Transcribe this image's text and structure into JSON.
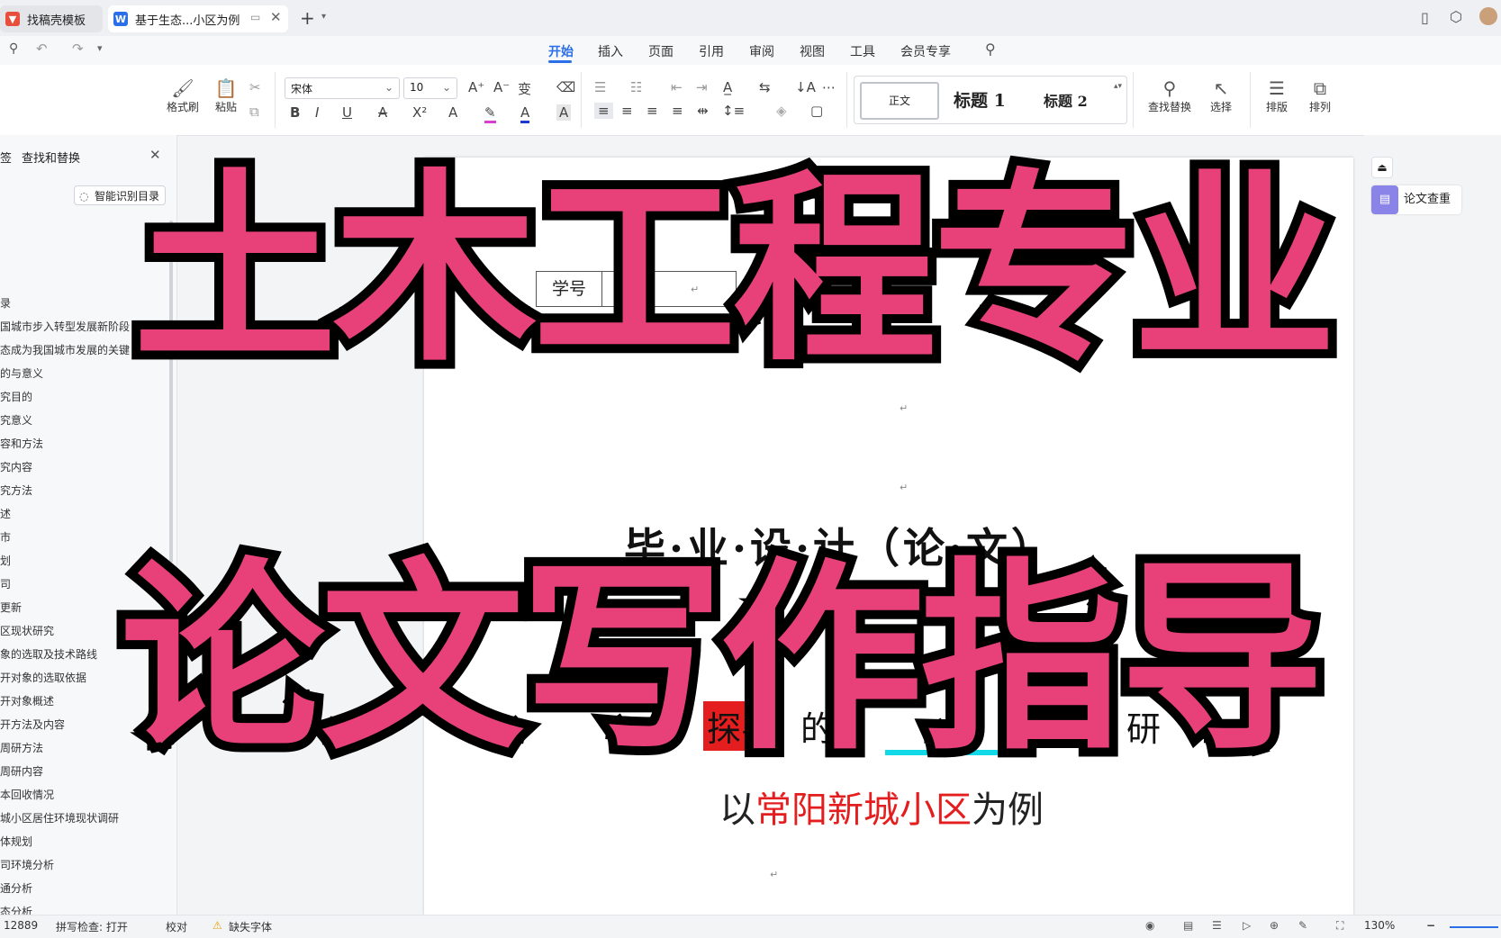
{
  "tabs": [
    {
      "label": "找稿壳模板"
    },
    {
      "label": "基于生态...小区为例"
    }
  ],
  "menu": [
    "开始",
    "插入",
    "页面",
    "引用",
    "审阅",
    "视图",
    "工具",
    "会员专享"
  ],
  "ribbon": {
    "format_painter": "格式刷",
    "paste": "粘贴",
    "font_name": "宋体",
    "font_size": "10",
    "style_normal": "正文",
    "style_h1": "标题 1",
    "style_h2": "标题 2",
    "find_replace": "查找替换",
    "select": "选择",
    "layout": "排版",
    "arrange": "排列"
  },
  "left_pane": {
    "tab_label": "签",
    "title": "查找和替换",
    "smart_toc_button": "智能识别目录",
    "outline": [
      "录",
      "国城市步入转型发展新阶段",
      "态成为我国城市发展的关键",
      "的与意义",
      "究目的",
      "究意义",
      "容和方法",
      "究内容",
      "究方法",
      "述",
      "市",
      "划",
      "司",
      "更新",
      "区现状研究",
      "象的选取及技术路线",
      "开对象的选取依据",
      "开对象概述",
      "开方法及内容",
      "周研方法",
      "周研内容",
      "本回收情况",
      "城小区居住环境现状调研",
      "体规划",
      "司环境分析",
      "通分析",
      "态分析"
    ]
  },
  "document": {
    "student_id_label": "学号",
    "thesis_heading": "毕·业·设·计（论·文）",
    "title_partial_1": "探导",
    "title_partial_2": "的",
    "title_partial_3": "研",
    "subtitle_prefix": "以",
    "subtitle_highlight": "常阳新城小区",
    "subtitle_suffix": "为例"
  },
  "right_pane": {
    "plagiarism_check": "论文查重"
  },
  "overlay": {
    "line1": "土木工程专业",
    "line2": "论文写作指导"
  },
  "status": {
    "word_count": "12889",
    "spell_check": "拼写检查: 打开",
    "proofread": "校对",
    "missing_font": "缺失字体",
    "zoom": "130%"
  },
  "colors": {
    "accent": "#2a6ee8",
    "overlay_fill": "#e8417a",
    "highlight_red": "#e41e1e"
  }
}
